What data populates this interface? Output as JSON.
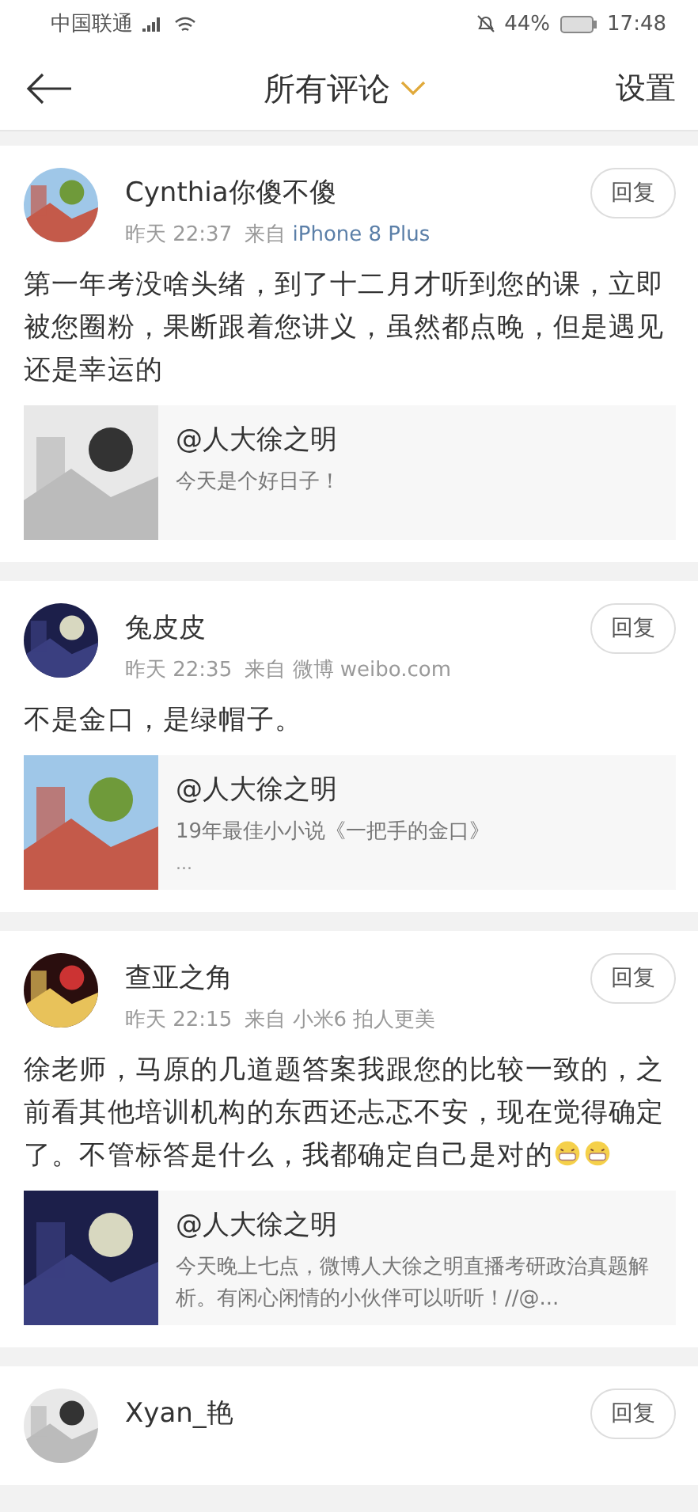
{
  "status_bar": {
    "carrier": "中国联通",
    "battery": "44%",
    "time": "17:48"
  },
  "header": {
    "title": "所有评论",
    "action": "设置"
  },
  "comments": [
    {
      "name": "Cynthia你傻不傻",
      "time": "昨天 22:37",
      "source_label": "来自",
      "source": "iPhone 8 Plus",
      "source_link": true,
      "text": "第一年考没啥头绪，到了十二月才听到您的课，立即被您圈粉，果断跟着您讲义，虽然都点晚，但是遇见还是幸运的",
      "reply": "回复",
      "quote": {
        "author": "@人大徐之明",
        "text": "今天是个好日子！"
      }
    },
    {
      "name": "兔皮皮",
      "time": "昨天 22:35",
      "source_label": "来自",
      "source": "微博 weibo.com",
      "source_link": false,
      "text": "不是金口，是绿帽子。",
      "reply": "回复",
      "quote": {
        "author": "@人大徐之明",
        "text": "19年最佳小小说《一把手的金口》",
        "more": "..."
      }
    },
    {
      "name": "查亚之角",
      "time": "昨天 22:15",
      "source_label": "来自",
      "source": "小米6 拍人更美",
      "source_link": false,
      "text": "徐老师，马原的几道题答案我跟您的比较一致的，之前看其他培训机构的东西还忐忑不安，现在觉得确定了。不管标答是什么，我都确定自己是对的",
      "emojis": [
        {
          "kind": "grin"
        },
        {
          "kind": "grin"
        }
      ],
      "reply": "回复",
      "quote": {
        "author": "@人大徐之明",
        "text": "今天晚上七点，微博人大徐之明直播考研政治真题解析。有闲心闲情的小伙伴可以听听！//@..."
      }
    },
    {
      "name": "Xyan_艳",
      "reply": "回复"
    }
  ]
}
